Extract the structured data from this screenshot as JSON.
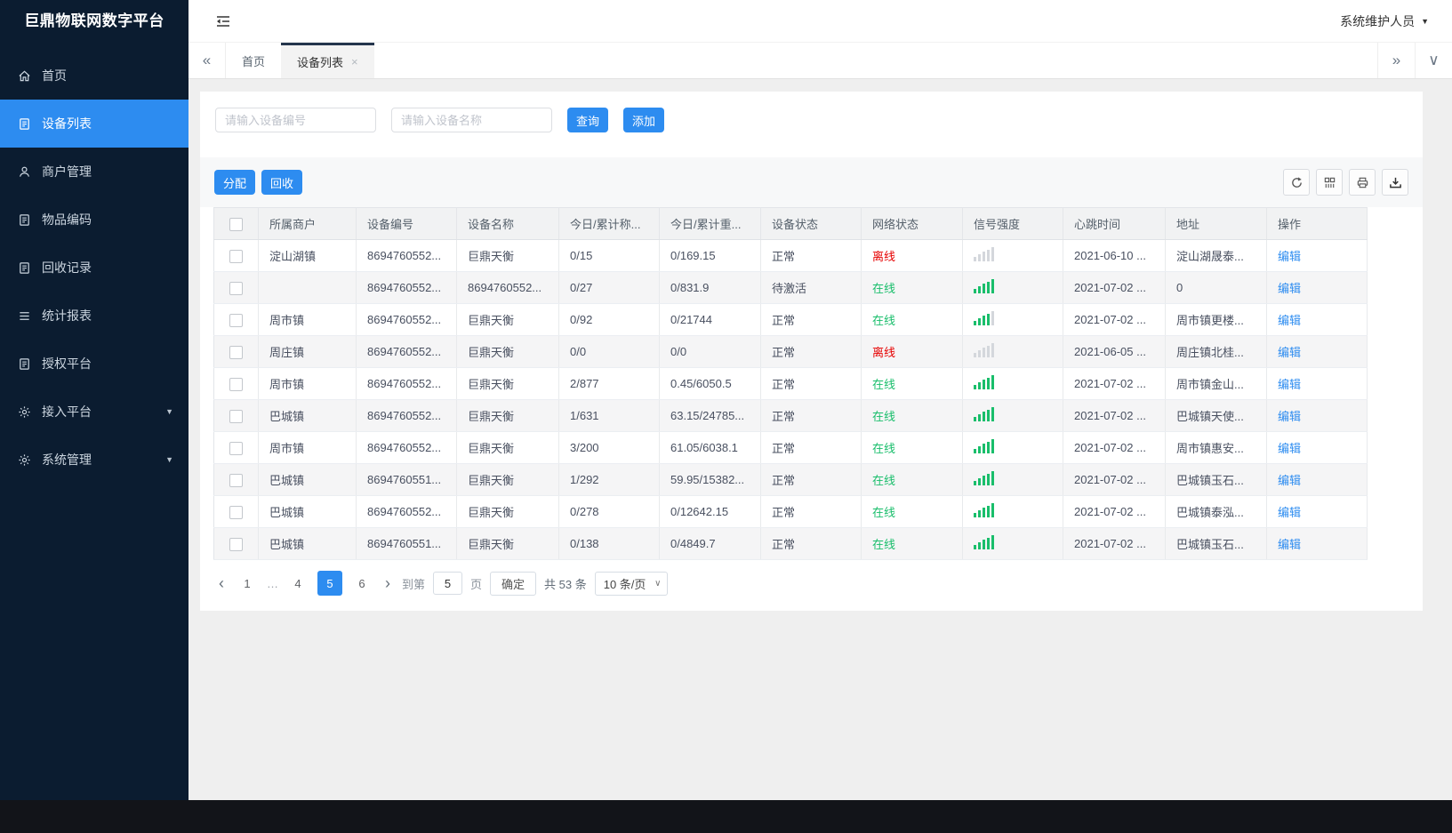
{
  "app": {
    "title": "巨鼎物联网数字平台",
    "user": "系统维护人员"
  },
  "colors": {
    "accent": "#2d8cf0",
    "success": "#19be6b",
    "danger": "#e60000",
    "sidebar_bg": "#0b1c30"
  },
  "sidebar": {
    "items": [
      {
        "label": "首页",
        "icon": "home",
        "active": false,
        "caret": false
      },
      {
        "label": "设备列表",
        "icon": "doc",
        "active": true,
        "caret": false
      },
      {
        "label": "商户管理",
        "icon": "user",
        "active": false,
        "caret": false
      },
      {
        "label": "物品编码",
        "icon": "doc",
        "active": false,
        "caret": false
      },
      {
        "label": "回收记录",
        "icon": "doc",
        "active": false,
        "caret": false
      },
      {
        "label": "统计报表",
        "icon": "lines",
        "active": false,
        "caret": false
      },
      {
        "label": "授权平台",
        "icon": "doc",
        "active": false,
        "caret": false
      },
      {
        "label": "接入平台",
        "icon": "gear",
        "active": false,
        "caret": true
      },
      {
        "label": "系统管理",
        "icon": "gear",
        "active": false,
        "caret": true
      }
    ]
  },
  "tabs": {
    "items": [
      {
        "label": "首页",
        "active": false,
        "closable": false
      },
      {
        "label": "设备列表",
        "active": true,
        "closable": true
      }
    ]
  },
  "search": {
    "device_no_placeholder": "请输入设备编号",
    "device_name_placeholder": "请输入设备名称",
    "query_label": "查询",
    "add_label": "添加"
  },
  "toolbar": {
    "assign_label": "分配",
    "recycle_label": "回收",
    "icons": [
      "refresh-icon",
      "columns-icon",
      "print-icon",
      "export-icon"
    ]
  },
  "table": {
    "headers": [
      "所属商户",
      "设备编号",
      "设备名称",
      "今日/累计称...",
      "今日/累计重...",
      "设备状态",
      "网络状态",
      "信号强度",
      "心跳时间",
      "地址",
      "操作"
    ],
    "edit_label": "编辑",
    "rows": [
      {
        "merchant": "淀山湖镇",
        "device_no": "8694760552...",
        "device_name": "巨鼎天衡",
        "today_count": "0/15",
        "today_weight": "0/169.15",
        "device_status": "正常",
        "network_status": "离线",
        "network_state": "offline",
        "signal_level": 0,
        "heartbeat": "2021-06-10 ...",
        "address": "淀山湖晟泰..."
      },
      {
        "merchant": "",
        "device_no": "8694760552...",
        "device_name": "8694760552...",
        "today_count": "0/27",
        "today_weight": "0/831.9",
        "device_status": "待激活",
        "network_status": "在线",
        "network_state": "online",
        "signal_level": 5,
        "heartbeat": "2021-07-02 ...",
        "address": "0"
      },
      {
        "merchant": "周市镇",
        "device_no": "8694760552...",
        "device_name": "巨鼎天衡",
        "today_count": "0/92",
        "today_weight": "0/21744",
        "device_status": "正常",
        "network_status": "在线",
        "network_state": "online",
        "signal_level": 4,
        "heartbeat": "2021-07-02 ...",
        "address": "周市镇更楼..."
      },
      {
        "merchant": "周庄镇",
        "device_no": "8694760552...",
        "device_name": "巨鼎天衡",
        "today_count": "0/0",
        "today_weight": "0/0",
        "device_status": "正常",
        "network_status": "离线",
        "network_state": "offline",
        "signal_level": 0,
        "heartbeat": "2021-06-05 ...",
        "address": "周庄镇北桂..."
      },
      {
        "merchant": "周市镇",
        "device_no": "8694760552...",
        "device_name": "巨鼎天衡",
        "today_count": "2/877",
        "today_weight": "0.45/6050.5",
        "device_status": "正常",
        "network_status": "在线",
        "network_state": "online",
        "signal_level": 5,
        "heartbeat": "2021-07-02 ...",
        "address": "周市镇金山..."
      },
      {
        "merchant": "巴城镇",
        "device_no": "8694760552...",
        "device_name": "巨鼎天衡",
        "today_count": "1/631",
        "today_weight": "63.15/24785...",
        "device_status": "正常",
        "network_status": "在线",
        "network_state": "online",
        "signal_level": 5,
        "heartbeat": "2021-07-02 ...",
        "address": "巴城镇天使..."
      },
      {
        "merchant": "周市镇",
        "device_no": "8694760552...",
        "device_name": "巨鼎天衡",
        "today_count": "3/200",
        "today_weight": "61.05/6038.1",
        "device_status": "正常",
        "network_status": "在线",
        "network_state": "online",
        "signal_level": 5,
        "heartbeat": "2021-07-02 ...",
        "address": "周市镇惠安..."
      },
      {
        "merchant": "巴城镇",
        "device_no": "8694760551...",
        "device_name": "巨鼎天衡",
        "today_count": "1/292",
        "today_weight": "59.95/15382...",
        "device_status": "正常",
        "network_status": "在线",
        "network_state": "online",
        "signal_level": 5,
        "heartbeat": "2021-07-02 ...",
        "address": "巴城镇玉石..."
      },
      {
        "merchant": "巴城镇",
        "device_no": "8694760552...",
        "device_name": "巨鼎天衡",
        "today_count": "0/278",
        "today_weight": "0/12642.15",
        "device_status": "正常",
        "network_status": "在线",
        "network_state": "online",
        "signal_level": 5,
        "heartbeat": "2021-07-02 ...",
        "address": "巴城镇泰泓..."
      },
      {
        "merchant": "巴城镇",
        "device_no": "8694760551...",
        "device_name": "巨鼎天衡",
        "today_count": "0/138",
        "today_weight": "0/4849.7",
        "device_status": "正常",
        "network_status": "在线",
        "network_state": "online",
        "signal_level": 5,
        "heartbeat": "2021-07-02 ...",
        "address": "巴城镇玉石..."
      }
    ]
  },
  "pagination": {
    "pages": [
      "1",
      "…",
      "4",
      "5",
      "6"
    ],
    "active": "5",
    "goto_label": "到第",
    "goto_value": "5",
    "page_label": "页",
    "confirm_label": "确定",
    "total_label": "共 53 条",
    "page_size": "10 条/页"
  }
}
